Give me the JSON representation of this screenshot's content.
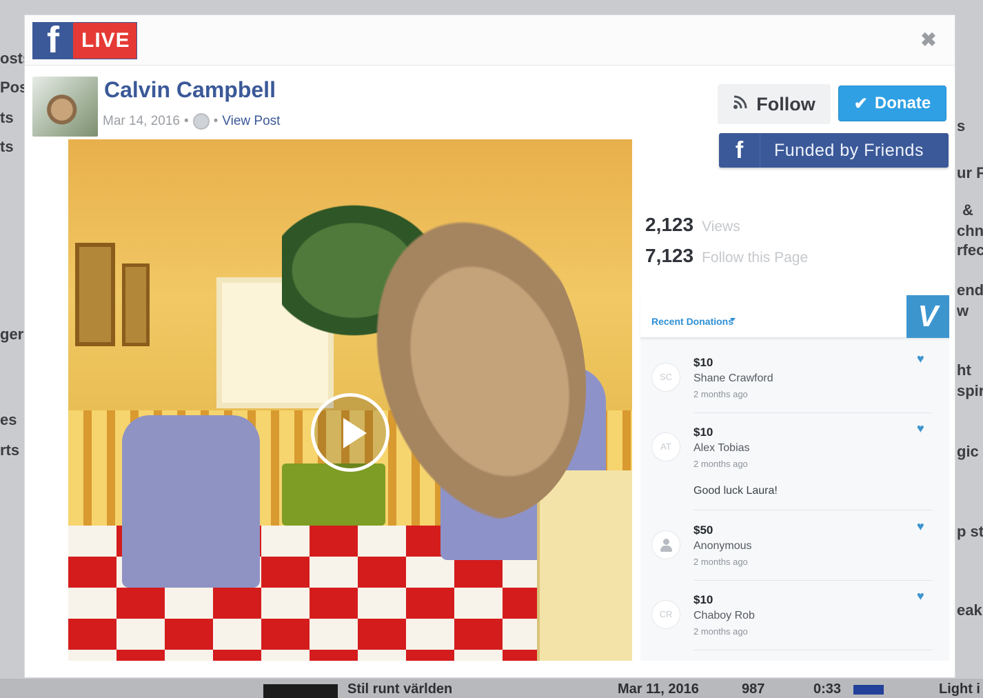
{
  "background": {
    "left_fragments": [
      "osts",
      "Post",
      "ts",
      "ts",
      "ger",
      "es",
      "rts"
    ],
    "right_fragments": [
      "s",
      "ur F",
      "&",
      "chno",
      "rfec",
      "endi",
      "w",
      "ht",
      "spira",
      "gic",
      "p st",
      "eak"
    ],
    "bottom_row": {
      "title": "Stil runt världen",
      "date": "Mar 11, 2016",
      "views": "987",
      "duration": "0:33",
      "extra": "Light i"
    }
  },
  "brand": {
    "icon": "facebook-f-icon",
    "letter": "f",
    "live_label": "LIVE"
  },
  "close": {
    "icon": "close-icon",
    "glyph": "✖"
  },
  "author": {
    "name": "Calvin Campbell",
    "date": "Mar 14, 2016",
    "separator": "•",
    "privacy_icon": "globe-icon",
    "view_post": "View Post"
  },
  "video": {
    "play_icon": "play-icon"
  },
  "actions": {
    "follow": {
      "icon": "rss-icon",
      "glyph": "ᯤ",
      "label": "Follow"
    },
    "donate": {
      "icon": "check-icon",
      "glyph": "✔",
      "label": "Donate"
    },
    "funded": {
      "icon": "facebook-f-icon",
      "glyph": "f",
      "label": "Funded by Friends"
    }
  },
  "stats": {
    "views": {
      "value": "2,123",
      "label": "Views"
    },
    "followers": {
      "value": "7,123",
      "label": "Follow this Page"
    }
  },
  "donations": {
    "header_label": "Recent Donations",
    "venmo_letter": "V",
    "items": [
      {
        "initials": "SC",
        "amount": "$10",
        "name": "Shane Crawford",
        "time": "2 months ago",
        "message": ""
      },
      {
        "initials": "AT",
        "amount": "$10",
        "name": "Alex Tobias",
        "time": "2 months ago",
        "message": "Good luck Laura!"
      },
      {
        "initials": "",
        "amount": "$50",
        "name": "Anonymous",
        "time": "2 months ago",
        "message": ""
      },
      {
        "initials": "CR",
        "amount": "$10",
        "name": "Chaboy Rob",
        "time": "2 months ago",
        "message": ""
      }
    ],
    "heart_glyph": "♥"
  },
  "colors": {
    "facebook_blue": "#3b5998",
    "donate_blue": "#2fa0e4",
    "venmo_blue": "#3d95ce",
    "live_red": "#e53935"
  }
}
